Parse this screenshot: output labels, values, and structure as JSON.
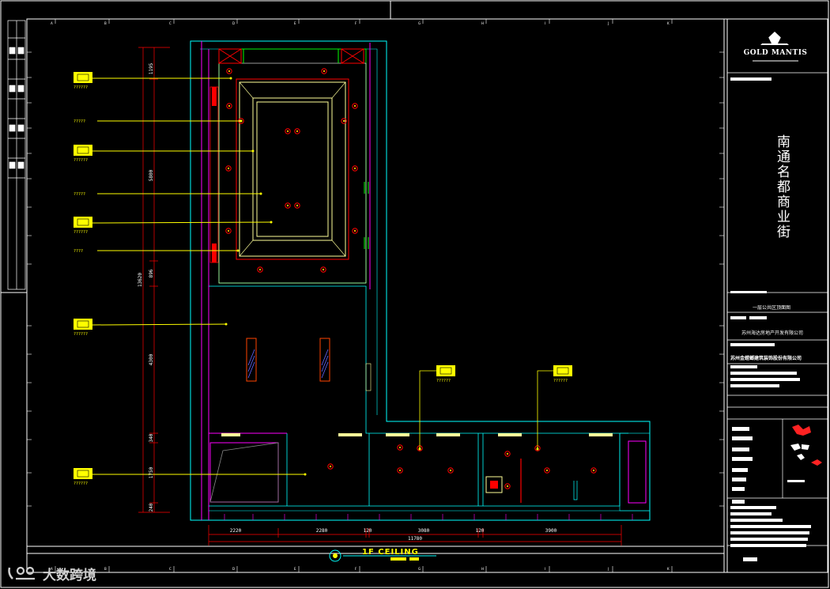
{
  "drawing": {
    "title": "1F CEILING",
    "overall_width": "11780",
    "overall_height": "13620",
    "dims_bottom": [
      "2220",
      "2280",
      "120",
      "3080",
      "120",
      "3900"
    ],
    "dims_left": [
      "1195",
      "5800",
      "896",
      "4300",
      "340",
      "1750",
      "240"
    ],
    "callout_labels": [
      "??????",
      "?????",
      "??????",
      "?????",
      "??????",
      "????",
      "??????",
      "??????",
      "??????",
      "??????"
    ],
    "grid_letters": [
      "A",
      "B",
      "C",
      "D",
      "E",
      "F",
      "G",
      "H",
      "I",
      "J",
      "K"
    ]
  },
  "title_block": {
    "brand": "GOLD MANTIS",
    "project_name": "南通名都商业街",
    "drawing_name": "一层公共区顶面图",
    "client_company": "苏州海达房地产开发有限公司",
    "designer_company": "苏州金螳螂建筑装饰股份有限公司"
  },
  "watermark": {
    "logo": "dashukuajing-logo-icon",
    "text": "大数跨境"
  },
  "colors": {
    "background": "#000000",
    "frame": "#ffffff",
    "cyan": "#00ffff",
    "magenta": "#ff00ff",
    "red": "#ff0000",
    "yellow": "#ffff00",
    "green": "#00ff00"
  }
}
